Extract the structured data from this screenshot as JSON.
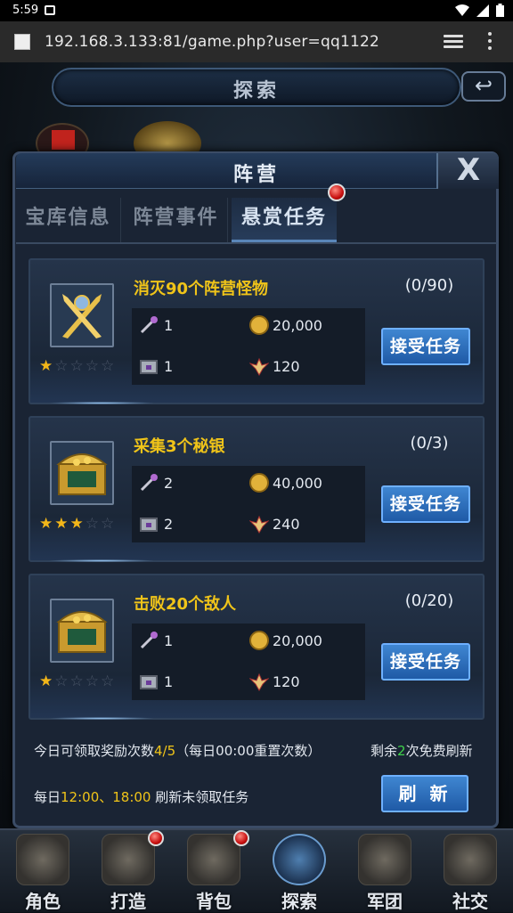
{
  "status_bar": {
    "time": "5:59"
  },
  "browser": {
    "url": "192.168.3.133:81/game.php?user=qq1122"
  },
  "background": {
    "title": "探索",
    "back_icon": "back-arrow-icon"
  },
  "dialog": {
    "title": "阵营",
    "close_label": "X",
    "tabs": [
      {
        "label": "宝库信息",
        "active": false
      },
      {
        "label": "阵营事件",
        "active": false
      },
      {
        "label": "悬赏任务",
        "active": true,
        "badge": true
      }
    ],
    "quests": [
      {
        "name": "消灭90个阵营怪物",
        "progress": "(0/90)",
        "icon": "crossed-swords-icon",
        "stars": 1,
        "max_stars": 5,
        "rewards": {
          "item1_count": "1",
          "gold": "20,000",
          "item2_count": "1",
          "honor": "120"
        },
        "button": "接受任务"
      },
      {
        "name": "采集3个秘银",
        "progress": "(0/3)",
        "icon": "treasure-chest-icon",
        "stars": 3,
        "max_stars": 5,
        "rewards": {
          "item1_count": "2",
          "gold": "40,000",
          "item2_count": "2",
          "honor": "240"
        },
        "button": "接受任务"
      },
      {
        "name": "击败20个敌人",
        "progress": "(0/20)",
        "icon": "treasure-chest-icon",
        "stars": 1,
        "max_stars": 5,
        "rewards": {
          "item1_count": "1",
          "gold": "20,000",
          "item2_count": "1",
          "honor": "120"
        },
        "button": "接受任务"
      }
    ],
    "footer": {
      "claims_prefix": "今日可领取奖励次数",
      "claims_value": "4/5",
      "claims_suffix": "（每日00:00重置次数）",
      "free_prefix": "剩余",
      "free_value": "2",
      "free_suffix": "次免费刷新",
      "schedule_prefix": "每日",
      "schedule_times": "12:00、18:00",
      "schedule_suffix": " 刷新未领取任务",
      "refresh_button": "刷 新"
    }
  },
  "bottom_nav": [
    {
      "label": "角色",
      "badge": false,
      "active": false
    },
    {
      "label": "打造",
      "badge": true,
      "active": false
    },
    {
      "label": "背包",
      "badge": true,
      "active": false
    },
    {
      "label": "探索",
      "badge": false,
      "active": true
    },
    {
      "label": "军团",
      "badge": false,
      "active": false
    },
    {
      "label": "社交",
      "badge": false,
      "active": false
    }
  ],
  "colors": {
    "accent_gold": "#f0c419",
    "button_blue": "#2f6fbf",
    "free_green": "#3fd34a",
    "badge_red": "#c81010"
  }
}
